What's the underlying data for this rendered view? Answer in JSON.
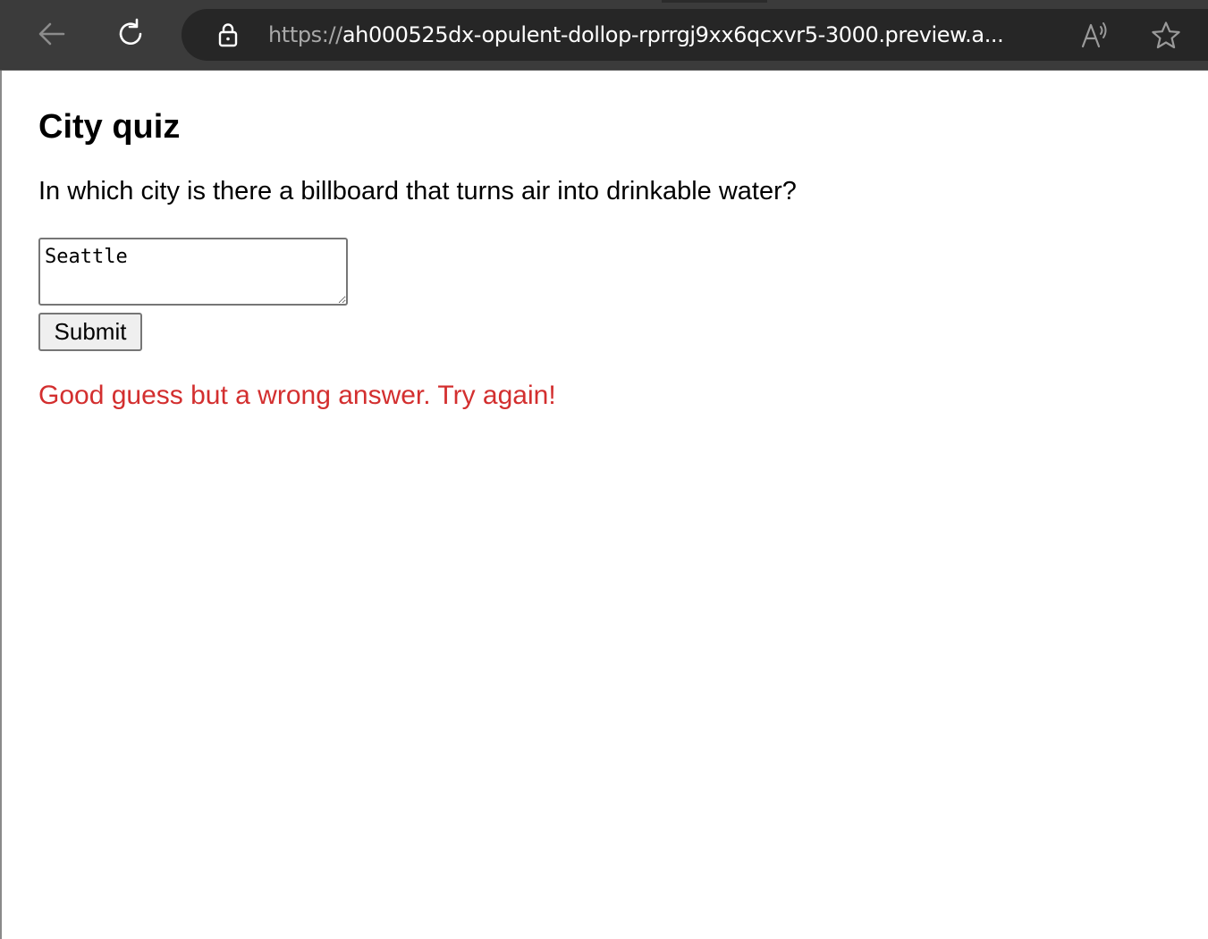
{
  "browser": {
    "url_scheme": "https://",
    "url_rest": "ah000525dx-opulent-dollop-rprrgj9xx6qcxvr5-3000.preview.a...",
    "icons": [
      "back-arrow-icon",
      "reload-icon",
      "lock-icon",
      "read-aloud-icon",
      "favorite-star-icon"
    ]
  },
  "quiz": {
    "title": "City quiz",
    "question": "In which city is there a billboard that turns air into drinkable water?",
    "answer_value": "Seattle",
    "submit_label": "Submit",
    "feedback": "Good guess but a wrong answer. Try again!",
    "feedback_color": "#d32f2f"
  }
}
